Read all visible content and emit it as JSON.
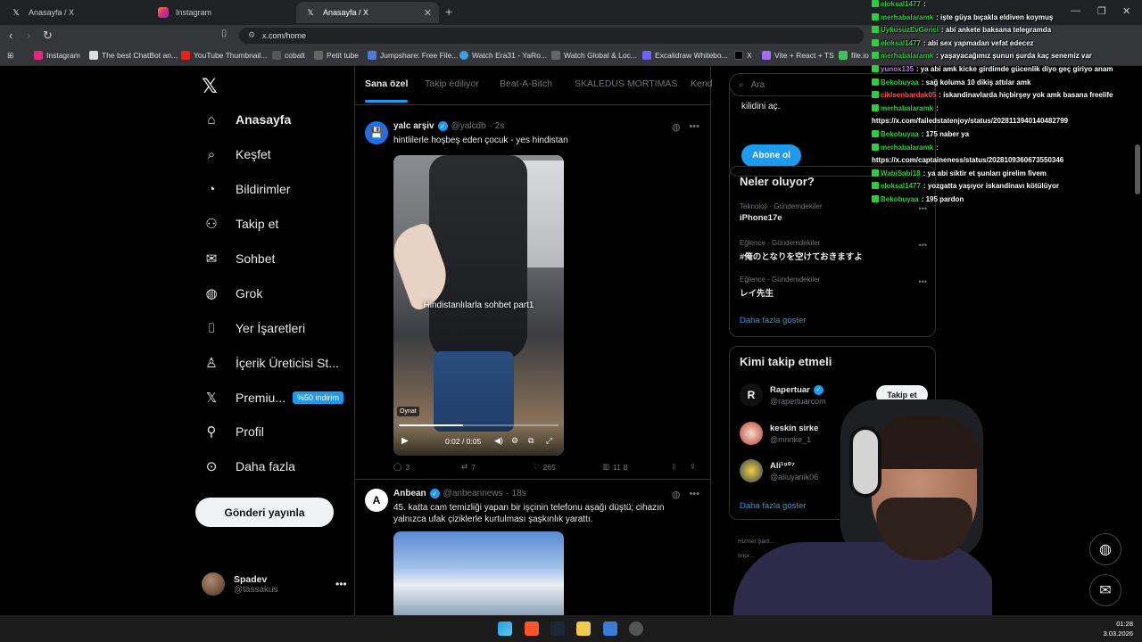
{
  "browser": {
    "tabs": [
      {
        "title": "Anasayfa / X",
        "icon": "x-icon"
      },
      {
        "title": "Instagram",
        "icon": "instagram-icon"
      },
      {
        "title": "Anasayfa / X",
        "icon": "x-icon",
        "active": true
      }
    ],
    "url": "x.com/home",
    "bookmarks": [
      "Instagram",
      "The best ChatBot an...",
      "YouTube Thumbnail...",
      "cobalt",
      "Petit tube",
      "Jumpshare: Free File...",
      "Watch Era31 - YaRo...",
      "Watch Global & Loc...",
      "Excalidraw Whitebo...",
      "X",
      "Vite + React + TS",
      "file.io"
    ]
  },
  "nav": {
    "items": [
      {
        "label": "Anasayfa",
        "icon": "home-icon",
        "glyph": "⌂"
      },
      {
        "label": "Keşfet",
        "icon": "search-icon",
        "glyph": "⌕"
      },
      {
        "label": "Bildirimler",
        "icon": "bell-icon",
        "glyph": "◔"
      },
      {
        "label": "Takip et",
        "icon": "add-user-icon",
        "glyph": "⚇"
      },
      {
        "label": "Sohbet",
        "icon": "mail-icon",
        "glyph": "✉"
      },
      {
        "label": "Grok",
        "icon": "grok-icon",
        "glyph": "◍"
      },
      {
        "label": "Yer İşaretleri",
        "icon": "bookmark-icon",
        "glyph": "⌷"
      },
      {
        "label": "İçerik Üreticisi St...",
        "icon": "creator-icon",
        "glyph": "♙"
      },
      {
        "label": "Premiu...",
        "icon": "premium-x-icon",
        "glyph": "𝕏"
      },
      {
        "label": "Profil",
        "icon": "profile-icon",
        "glyph": "⚲"
      },
      {
        "label": "Daha fazla",
        "icon": "more-circle-icon",
        "glyph": "⊙"
      }
    ],
    "premium_badge": "%50 indirim",
    "post_button": "Gönderi yayınla",
    "user": {
      "name": "Spadev",
      "handle": "@tassakus"
    }
  },
  "feed": {
    "tabs": [
      "Sana özel",
      "Takip ediliyor",
      "Beat-A-Bitch",
      "SKALEDUS MORTIMAS",
      "Kend"
    ],
    "posts": [
      {
        "name": "yalc arşiv",
        "handle": "@yalcdb",
        "time": "· 2s",
        "text": "hintlilerle hoşbeş eden çocuk - yes hindistan",
        "video": {
          "caption": "Hindistanlılarla sohbet part1",
          "tooltip": "Oynat",
          "time": "0:02 / 0:05",
          "progress": 0.4
        },
        "stats": {
          "replies": "3",
          "reposts": "7",
          "likes": "265",
          "views": "11 B"
        }
      },
      {
        "name": "Anbean",
        "handle": "@anbeannews",
        "time": "· 18s",
        "text": "45. katta cam temizliği yapan bir işçinin telefonu aşağı düştü; cihazın yalnızca ufak çiziklerle kurtulması şaşkınlık yarattı."
      }
    ]
  },
  "sidebar": {
    "search_placeholder": "Ara",
    "premium_card": {
      "text": "kilidini aç.",
      "button": "Abone ol"
    },
    "trends_title": "Neler oluyor?",
    "trends": [
      {
        "category": "Teknoloji · Gündemdekiler",
        "title": "iPhone17e"
      },
      {
        "category": "Eğlence · Gündemdekiler",
        "title": "#俺のとなりを空けておきますよ"
      },
      {
        "category": "Eğlence · Gündemdekiler",
        "title": "レイ先生"
      }
    ],
    "show_more": "Daha fazla göster",
    "who_title": "Kimi takip etmeli",
    "who": [
      {
        "name": "Rapertuar",
        "handle": "@rapertuarcom",
        "verified": true
      },
      {
        "name": "keskin sirke",
        "handle": "@mnnke_1"
      },
      {
        "name": "Ali¹⁹⁰⁷",
        "handle": "@aliuyanik06"
      }
    ],
    "follow_button": "Takip et",
    "footer": [
      "Hizmet Şartl...",
      "Impr..."
    ]
  },
  "chat": [
    {
      "user": "eloksal1477",
      "msg": ":",
      "color": "#2ecc40"
    },
    {
      "user": "merhabalaramk",
      "msg": ": işte güya bıçakla eldiven koymuş",
      "color": "#2ecc40"
    },
    {
      "user": "UykusuzEvGenci",
      "msg": ": abi ankete baksana telegramda",
      "color": "#2ecc40"
    },
    {
      "user": "eloksal1477",
      "msg": ": abi sex yapmadan vefat edecez",
      "color": "#2ecc40"
    },
    {
      "user": "merhabalaramk",
      "msg": ": yaşayacağımız şunun şurda kaç senemiz var",
      "color": "#2ecc40"
    },
    {
      "user": "yunox135",
      "msg": ": ya abi amk kicke girdimde gücenlik diyo geç giriyo anam",
      "color": "#b57edc"
    },
    {
      "user": "Bekobuyaa",
      "msg": ": sağ koluma 10 dikiş attılar amk",
      "color": "#2ecc40"
    },
    {
      "user": "ciklsenbardak05",
      "msg": ": iskandinavlarda hiçbirşey yok amk basana freelife",
      "color": "#ff4b4b"
    },
    {
      "user": "merhabalaramk",
      "msg": ":",
      "color": "#2ecc40"
    },
    {
      "user": "",
      "msg": "https://x.com/failedstatenjoy/status/2028113940140482799",
      "color": "#ffffff"
    },
    {
      "user": "Bekobuyaa",
      "msg": ": 175 naber ya",
      "color": "#2ecc40"
    },
    {
      "user": "merhabalaramk",
      "msg": ":",
      "color": "#2ecc40"
    },
    {
      "user": "",
      "msg": "https://x.com/captaineness/status/2028109360673550346",
      "color": "#ffffff"
    },
    {
      "user": "WabiSabi18",
      "msg": ": ya abi siktir et şunları girelim fivem",
      "color": "#2ecc40"
    },
    {
      "user": "eloksal1477",
      "msg": ": yozgatta yaşıyor iskandinavı kötülüyor",
      "color": "#2ecc40"
    },
    {
      "user": "Bekobuyaa",
      "msg": ": 195 pardon",
      "color": "#2ecc40"
    }
  ],
  "taskbar": {
    "time": "01:28",
    "date": "3.03.2026"
  }
}
